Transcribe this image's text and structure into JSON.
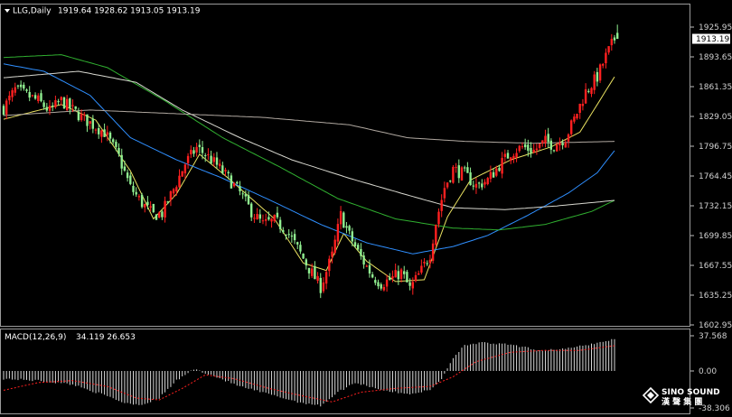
{
  "header": {
    "symbol": "LLG,Daily",
    "ohlc": "1919.64 1928.62 1913.05 1913.19",
    "macd_label": "MACD(12,26,9)",
    "macd_values": "34.119 26.653"
  },
  "price_box": "1913.19",
  "logo": {
    "line1": "SINO SOUND",
    "line2": "漢 聲 集 團"
  },
  "colors": {
    "background": "#000000",
    "up": "#ff2020",
    "down": "#90ee90",
    "ma_yellow": "#e8e060",
    "ma_blue": "#2f8fff",
    "ma_green": "#30b030",
    "ma_white": "#d8d8d0",
    "ma_gray": "#b0a8a0",
    "macd_hist": "#d8d8d8",
    "macd_signal": "#ff2020",
    "axis": "#c0c0c0"
  },
  "chart_data": [
    {
      "type": "candlestick",
      "title": "LLG,Daily",
      "ylim": [
        1595,
        1935
      ],
      "y_ticks": [
        "1925.95",
        "1893.65",
        "1861.35",
        "1829.05",
        "1796.75",
        "1764.45",
        "1732.15",
        "1699.85",
        "1667.55",
        "1635.25",
        "1602.95"
      ],
      "y_tick_values": [
        1925.95,
        1893.65,
        1861.35,
        1829.05,
        1796.75,
        1764.45,
        1732.15,
        1699.85,
        1667.55,
        1635.25,
        1602.95
      ],
      "anchors": [
        [
          0,
          1838
        ],
        [
          4,
          1858
        ],
        [
          8,
          1852
        ],
        [
          12,
          1846
        ],
        [
          16,
          1835
        ],
        [
          20,
          1846
        ],
        [
          24,
          1836
        ],
        [
          28,
          1826
        ],
        [
          31,
          1820
        ],
        [
          35,
          1812
        ],
        [
          40,
          1785
        ],
        [
          44,
          1752
        ],
        [
          48,
          1735
        ],
        [
          52,
          1722
        ],
        [
          55,
          1724
        ],
        [
          59,
          1750
        ],
        [
          63,
          1778
        ],
        [
          67,
          1795
        ],
        [
          70,
          1788
        ],
        [
          74,
          1776
        ],
        [
          78,
          1762
        ],
        [
          82,
          1746
        ],
        [
          86,
          1726
        ],
        [
          90,
          1712
        ],
        [
          94,
          1716
        ],
        [
          98,
          1706
        ],
        [
          102,
          1686
        ],
        [
          106,
          1664
        ],
        [
          110,
          1644
        ],
        [
          114,
          1678
        ],
        [
          117,
          1722
        ],
        [
          120,
          1700
        ],
        [
          124,
          1676
        ],
        [
          128,
          1656
        ],
        [
          131,
          1648
        ],
        [
          134,
          1652
        ],
        [
          138,
          1660
        ],
        [
          141,
          1642
        ],
        [
          145,
          1662
        ],
        [
          148,
          1680
        ],
        [
          150,
          1714
        ],
        [
          153,
          1752
        ],
        [
          156,
          1772
        ],
        [
          160,
          1766
        ],
        [
          164,
          1754
        ],
        [
          168,
          1760
        ],
        [
          172,
          1776
        ],
        [
          176,
          1790
        ],
        [
          180,
          1796
        ],
        [
          184,
          1792
        ],
        [
          188,
          1802
        ],
        [
          191,
          1798
        ],
        [
          195,
          1806
        ],
        [
          198,
          1826
        ],
        [
          202,
          1856
        ],
        [
          206,
          1872
        ],
        [
          209,
          1894
        ],
        [
          212,
          1913
        ]
      ],
      "moving_averages": [
        {
          "color_key": "ma_yellow",
          "points": [
            [
              0,
              1826
            ],
            [
              20,
              1842
            ],
            [
              32,
              1825
            ],
            [
              44,
              1770
            ],
            [
              52,
              1718
            ],
            [
              60,
              1745
            ],
            [
              68,
              1788
            ],
            [
              78,
              1762
            ],
            [
              94,
              1718
            ],
            [
              104,
              1670
            ],
            [
              112,
              1662
            ],
            [
              118,
              1702
            ],
            [
              126,
              1672
            ],
            [
              136,
              1650
            ],
            [
              146,
              1652
            ],
            [
              154,
              1720
            ],
            [
              162,
              1760
            ],
            [
              176,
              1782
            ],
            [
              190,
              1796
            ],
            [
              200,
              1812
            ],
            [
              212,
              1872
            ]
          ]
        },
        {
          "color_key": "ma_blue",
          "points": [
            [
              0,
              1886
            ],
            [
              14,
              1878
            ],
            [
              30,
              1852
            ],
            [
              44,
              1806
            ],
            [
              60,
              1782
            ],
            [
              76,
              1762
            ],
            [
              94,
              1736
            ],
            [
              110,
              1712
            ],
            [
              126,
              1692
            ],
            [
              142,
              1680
            ],
            [
              156,
              1688
            ],
            [
              168,
              1700
            ],
            [
              182,
              1722
            ],
            [
              196,
              1746
            ],
            [
              206,
              1768
            ],
            [
              212,
              1792
            ]
          ]
        },
        {
          "color_key": "ma_green",
          "points": [
            [
              0,
              1893
            ],
            [
              20,
              1896
            ],
            [
              36,
              1882
            ],
            [
              56,
              1846
            ],
            [
              76,
              1806
            ],
            [
              96,
              1774
            ],
            [
              116,
              1740
            ],
            [
              136,
              1718
            ],
            [
              156,
              1708
            ],
            [
              172,
              1706
            ],
            [
              188,
              1712
            ],
            [
              204,
              1726
            ],
            [
              212,
              1738
            ]
          ]
        },
        {
          "color_key": "ma_white",
          "points": [
            [
              0,
              1871
            ],
            [
              26,
              1878
            ],
            [
              46,
              1866
            ],
            [
              62,
              1836
            ],
            [
              82,
              1806
            ],
            [
              100,
              1782
            ],
            [
              120,
              1762
            ],
            [
              140,
              1744
            ],
            [
              156,
              1730
            ],
            [
              174,
              1728
            ],
            [
              192,
              1732
            ],
            [
              212,
              1738
            ]
          ]
        },
        {
          "color_key": "ma_gray",
          "points": [
            [
              0,
              1830
            ],
            [
              30,
              1836
            ],
            [
              60,
              1832
            ],
            [
              90,
              1828
            ],
            [
              120,
              1820
            ],
            [
              140,
              1806
            ],
            [
              160,
              1802
            ],
            [
              184,
              1800
            ],
            [
              212,
              1802
            ]
          ]
        }
      ],
      "last_price": 1913.19
    },
    {
      "type": "macd",
      "title": "MACD(12,26,9)",
      "values_label": "34.119 26.653",
      "ylim": [
        -40,
        40
      ],
      "y_ticks": [
        "37.568",
        "0.00",
        "-38.306"
      ],
      "y_tick_values": [
        37.568,
        0.0,
        -38.306
      ],
      "histogram_anchors": [
        [
          0,
          -8
        ],
        [
          12,
          -10
        ],
        [
          24,
          -14
        ],
        [
          34,
          -24
        ],
        [
          42,
          -33
        ],
        [
          48,
          -35
        ],
        [
          54,
          -28
        ],
        [
          60,
          -10
        ],
        [
          66,
          2
        ],
        [
          72,
          -4
        ],
        [
          82,
          -16
        ],
        [
          92,
          -24
        ],
        [
          102,
          -32
        ],
        [
          110,
          -36
        ],
        [
          116,
          -22
        ],
        [
          122,
          -12
        ],
        [
          132,
          -20
        ],
        [
          140,
          -24
        ],
        [
          148,
          -20
        ],
        [
          152,
          -8
        ],
        [
          156,
          14
        ],
        [
          160,
          28
        ],
        [
          166,
          30
        ],
        [
          176,
          28
        ],
        [
          186,
          22
        ],
        [
          196,
          24
        ],
        [
          206,
          30
        ],
        [
          212,
          34
        ]
      ],
      "signal_anchors": [
        [
          0,
          -20
        ],
        [
          12,
          -12
        ],
        [
          24,
          -10
        ],
        [
          36,
          -16
        ],
        [
          46,
          -28
        ],
        [
          54,
          -30
        ],
        [
          62,
          -18
        ],
        [
          70,
          -4
        ],
        [
          80,
          -8
        ],
        [
          92,
          -18
        ],
        [
          104,
          -26
        ],
        [
          114,
          -32
        ],
        [
          124,
          -22
        ],
        [
          136,
          -18
        ],
        [
          148,
          -16
        ],
        [
          156,
          -6
        ],
        [
          164,
          10
        ],
        [
          176,
          20
        ],
        [
          188,
          22
        ],
        [
          200,
          22
        ],
        [
          212,
          27
        ]
      ]
    }
  ]
}
